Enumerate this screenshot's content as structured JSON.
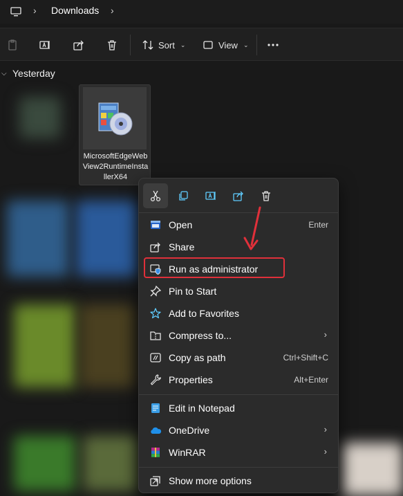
{
  "addressbar": {
    "location": "Downloads"
  },
  "toolbar": {
    "sort_label": "Sort",
    "view_label": "View"
  },
  "section": {
    "title": "Yesterday"
  },
  "file": {
    "name": "MicrosoftEdgeWebView2RuntimeInstallerX64"
  },
  "menu": {
    "items": [
      {
        "label": "Open",
        "shortcut": "Enter"
      },
      {
        "label": "Share",
        "shortcut": ""
      },
      {
        "label": "Run as administrator",
        "shortcut": ""
      },
      {
        "label": "Pin to Start",
        "shortcut": ""
      },
      {
        "label": "Add to Favorites",
        "shortcut": ""
      },
      {
        "label": "Compress to...",
        "shortcut": ""
      },
      {
        "label": "Copy as path",
        "shortcut": "Ctrl+Shift+C"
      },
      {
        "label": "Properties",
        "shortcut": "Alt+Enter"
      },
      {
        "label": "Edit in Notepad",
        "shortcut": ""
      },
      {
        "label": "OneDrive",
        "shortcut": ""
      },
      {
        "label": "WinRAR",
        "shortcut": ""
      },
      {
        "label": "Show more options",
        "shortcut": ""
      }
    ]
  },
  "colors": {
    "accent": "#60cdff",
    "highlight_box": "#e0303a",
    "menu_bg": "#2b2b2b"
  }
}
